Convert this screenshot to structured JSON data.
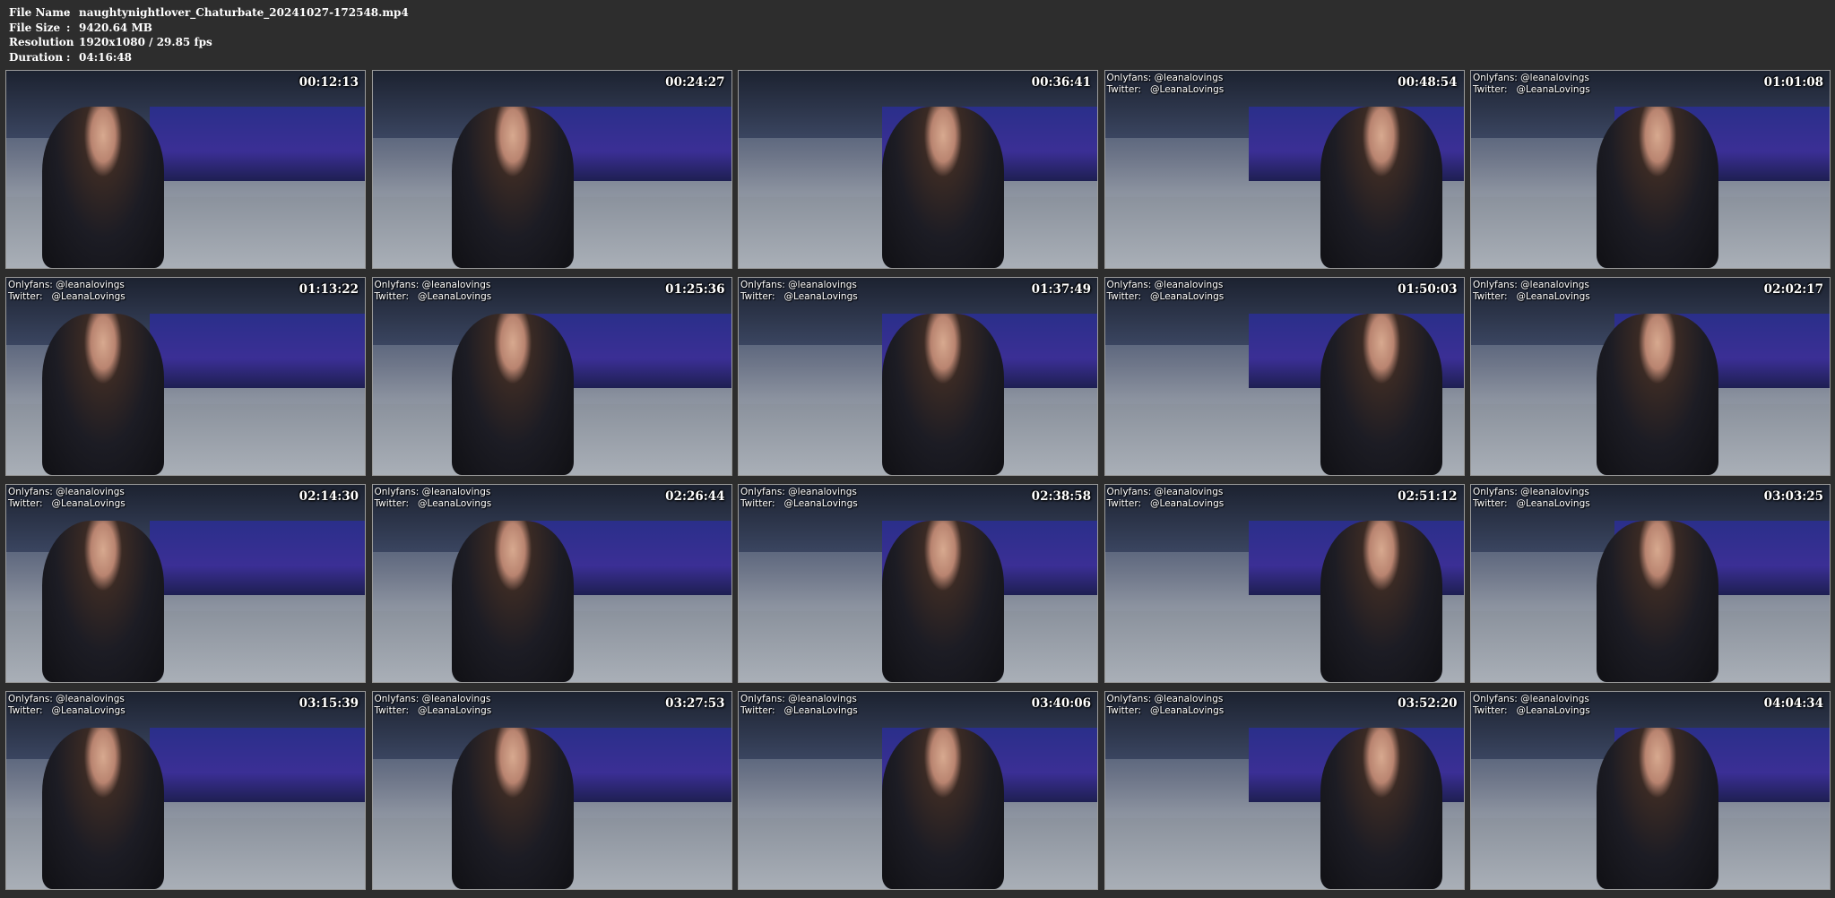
{
  "file_info": {
    "rows": [
      {
        "label": "File Name",
        "value": "naughtynightlover_Chaturbate_20241027-172548.mp4"
      },
      {
        "label": "File Size",
        "value": "9420.64 MB"
      },
      {
        "label": "Resolution",
        "value": "1920x1080 / 29.85 fps"
      },
      {
        "label": "Duration",
        "value": "04:16:48"
      }
    ],
    "separator": ":"
  },
  "watermark": {
    "line1": "Onlyfans: @leanalovings",
    "line2": "Twitter:   @LeanaLovings"
  },
  "thumbnails": [
    {
      "time": "00:12:13",
      "show_watermark": false
    },
    {
      "time": "00:24:27",
      "show_watermark": false
    },
    {
      "time": "00:36:41",
      "show_watermark": false
    },
    {
      "time": "00:48:54",
      "show_watermark": true
    },
    {
      "time": "01:01:08",
      "show_watermark": true
    },
    {
      "time": "01:13:22",
      "show_watermark": true
    },
    {
      "time": "01:25:36",
      "show_watermark": true
    },
    {
      "time": "01:37:49",
      "show_watermark": true
    },
    {
      "time": "01:50:03",
      "show_watermark": true
    },
    {
      "time": "02:02:17",
      "show_watermark": true
    },
    {
      "time": "02:14:30",
      "show_watermark": true
    },
    {
      "time": "02:26:44",
      "show_watermark": true
    },
    {
      "time": "02:38:58",
      "show_watermark": true
    },
    {
      "time": "02:51:12",
      "show_watermark": true
    },
    {
      "time": "03:03:25",
      "show_watermark": true
    },
    {
      "time": "03:15:39",
      "show_watermark": true
    },
    {
      "time": "03:27:53",
      "show_watermark": true
    },
    {
      "time": "03:40:06",
      "show_watermark": true
    },
    {
      "time": "03:52:20",
      "show_watermark": true
    },
    {
      "time": "04:04:34",
      "show_watermark": true
    }
  ],
  "colors": {
    "background": "#2d2d2d",
    "text": "#ffffff",
    "banner_accent": "#ff3a6a"
  }
}
